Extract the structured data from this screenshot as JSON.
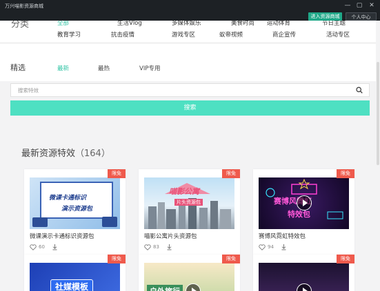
{
  "titlebar": {
    "title": "万兴喵影资源商城",
    "enter_store": "进入资源商城",
    "user_center": "个人中心",
    "min": "—",
    "max": "▢",
    "close": "✕"
  },
  "categories": {
    "heading": "分类",
    "row1": [
      "全部",
      "生活Vlog",
      "多媒体娱乐",
      "美食时尚",
      "运动体育",
      "节日主题"
    ],
    "row2": [
      "教育学习",
      "抗击疫情",
      "游戏专区",
      "蚁帝视频",
      "商企宣传",
      "活动专区"
    ]
  },
  "filter": {
    "heading": "精选",
    "tabs": [
      "最新",
      "最热",
      "VIP专用"
    ]
  },
  "search": {
    "placeholder": "搜索特效",
    "button": "搜索"
  },
  "section": {
    "title": "最新资源特效",
    "count": "（164）"
  },
  "cards": [
    {
      "badge": "限免",
      "title": "微课演示卡通标识资源包",
      "likes": "60",
      "thumb_text": [
        "微课卡通标识",
        "演示资源包"
      ]
    },
    {
      "badge": "限免",
      "title": "喵影公寓片头资源包",
      "likes": "83",
      "thumb_text": [
        "喵影公寓",
        "片头资源包"
      ]
    },
    {
      "badge": "限免",
      "title": "赛博风霓虹特效包",
      "likes": "94",
      "thumb_text": [
        "赛博风霓虹",
        "特效包"
      ]
    }
  ],
  "cards_row2": [
    {
      "badge": "限免",
      "thumb_text": "社媒模板"
    },
    {
      "badge": "限免",
      "thumb_text": "户外旅行"
    },
    {
      "badge": "限免",
      "thumb_text": ""
    }
  ],
  "colors": {
    "accent": "#31c4a5",
    "search_button": "#4ee0c2",
    "badge": "#ef5a4c",
    "titlebar": "#1d2125"
  }
}
